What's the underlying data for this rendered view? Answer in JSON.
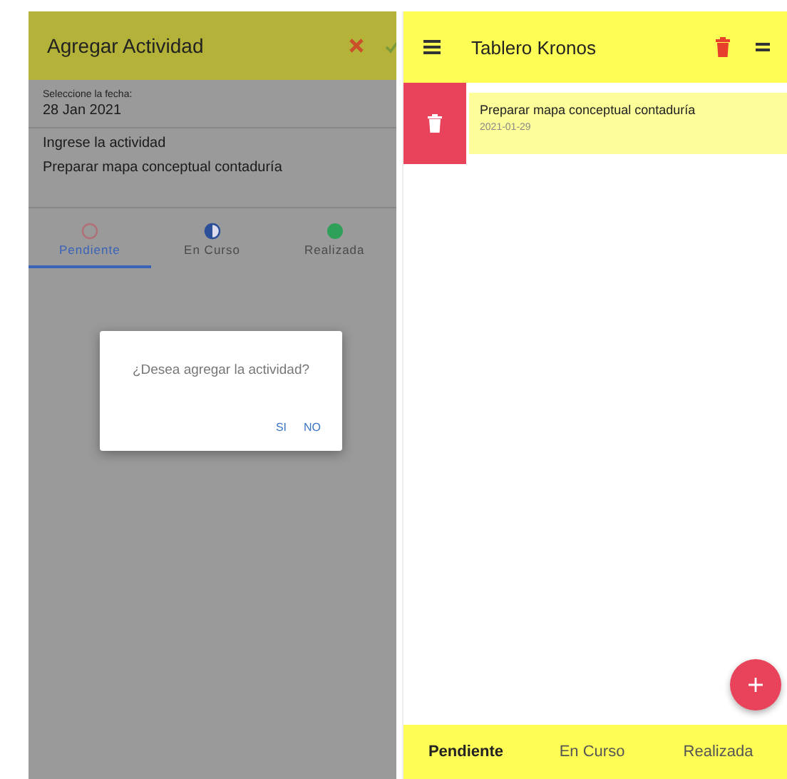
{
  "add_screen": {
    "title": "Agregar Actividad",
    "date_label": "Seleccione la fecha:",
    "date_value": "28 Jan 2021",
    "activity_label": "Ingrese la actividad",
    "activity_value": "Preparar mapa conceptual contaduría",
    "status_tabs": [
      {
        "label": "Pendiente",
        "kind": "pending",
        "selected": true
      },
      {
        "label": "En Curso",
        "kind": "in_progress",
        "selected": false
      },
      {
        "label": "Realizada",
        "kind": "done",
        "selected": false
      }
    ]
  },
  "dialog": {
    "message": "¿Desea agregar la actividad?",
    "buttons": [
      "SI",
      "NO"
    ]
  },
  "board": {
    "title": "Tablero Kronos",
    "activities": [
      {
        "title": "Preparar mapa conceptual contaduría",
        "date": "2021-01-29"
      }
    ],
    "bottom_tabs": [
      {
        "label": "Pendiente",
        "selected": true
      },
      {
        "label": "En Curso",
        "selected": false
      },
      {
        "label": "Realizada",
        "selected": false
      }
    ]
  }
}
